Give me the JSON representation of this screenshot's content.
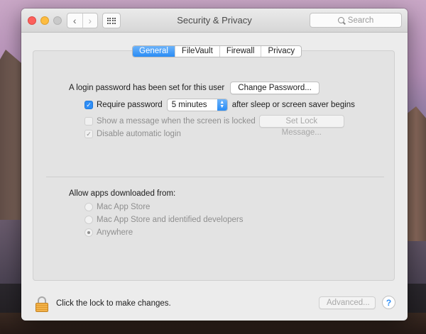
{
  "window": {
    "title": "Security & Privacy"
  },
  "toolbar": {
    "back_icon": "‹",
    "forward_icon": "›",
    "search_placeholder": "Search"
  },
  "tabs": [
    {
      "label": "General",
      "active": true
    },
    {
      "label": "FileVault",
      "active": false
    },
    {
      "label": "Firewall",
      "active": false
    },
    {
      "label": "Privacy",
      "active": false
    }
  ],
  "general": {
    "login_text": "A login password has been set for this user",
    "change_password_label": "Change Password...",
    "require_password_label": "Require password",
    "require_password_checked": true,
    "require_password_value": "5 minutes",
    "require_password_suffix": "after sleep or screen saver begins",
    "show_message_label": "Show a message when the screen is locked",
    "show_message_checked": false,
    "set_lock_message_label": "Set Lock Message...",
    "disable_login_label": "Disable automatic login",
    "disable_login_checked": true
  },
  "gatekeeper": {
    "heading": "Allow apps downloaded from:",
    "options": [
      {
        "label": "Mac App Store",
        "selected": false
      },
      {
        "label": "Mac App Store and identified developers",
        "selected": false
      },
      {
        "label": "Anywhere",
        "selected": true
      }
    ]
  },
  "footer": {
    "lock_text": "Click the lock to make changes.",
    "advanced_label": "Advanced...",
    "help_label": "?"
  },
  "colors": {
    "accent": "#2a8cf5",
    "close": "#fc605c",
    "minimize": "#fdbc40",
    "lock": "#f2b24a"
  }
}
